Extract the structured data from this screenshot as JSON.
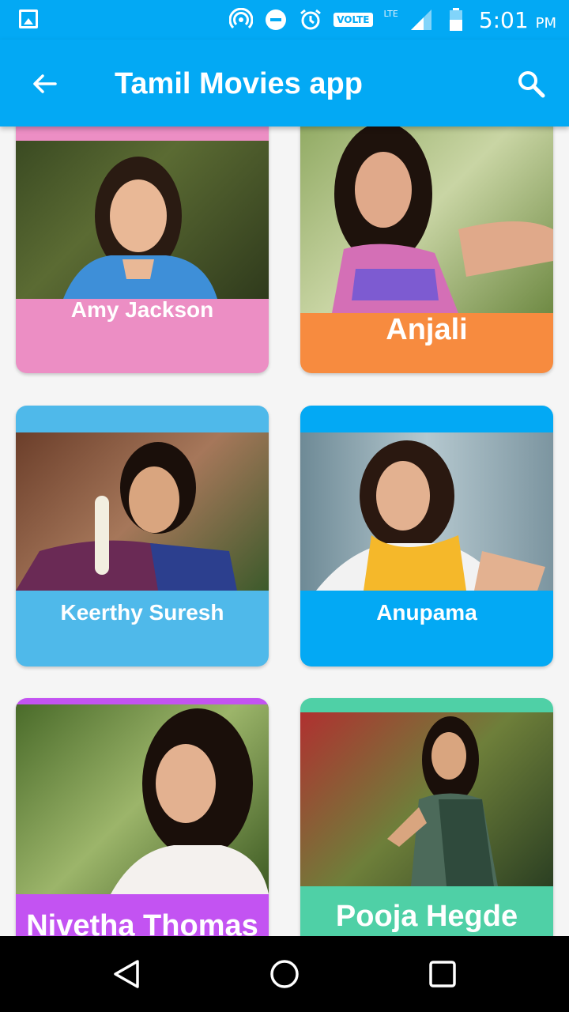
{
  "status_bar": {
    "network_badge": "VOLTE",
    "lte_label": "LTE",
    "time": "5:01",
    "ampm": "PM"
  },
  "app_bar": {
    "title": "Tamil Movies app"
  },
  "actresses": [
    {
      "name": "Amy Jackson",
      "accent": "#ec8ec4"
    },
    {
      "name": "Anjali",
      "accent": "#f78b3f"
    },
    {
      "name": "Keerthy Suresh",
      "accent": "#4fb9ea"
    },
    {
      "name": "Anupama",
      "accent": "#03a9f4"
    },
    {
      "name": "Nivetha Thomas",
      "accent": "#c353f2"
    },
    {
      "name": "Pooja Hegde",
      "accent": "#4fd0a6"
    }
  ],
  "colors": {
    "primary": "#03a9f4",
    "background": "#f5f5f5"
  }
}
